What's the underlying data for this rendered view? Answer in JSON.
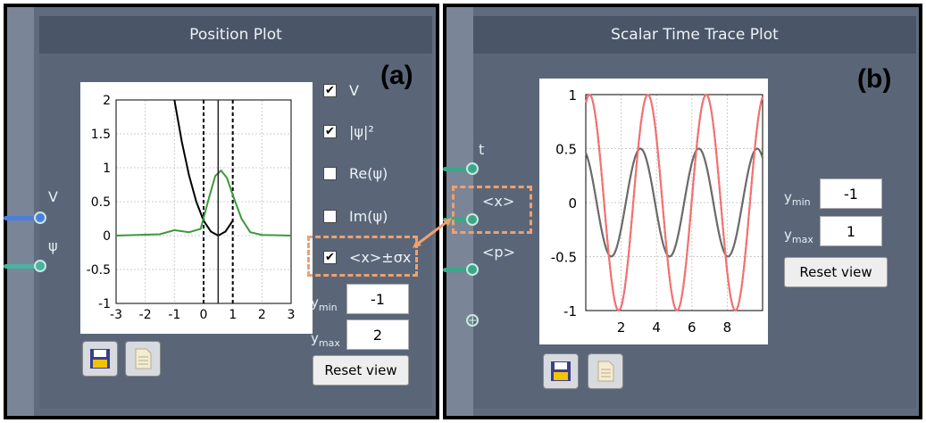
{
  "panel_a": {
    "tag": "(a)",
    "title": "Position Plot",
    "ports": [
      {
        "label": "V",
        "color": "#4a7fe0"
      },
      {
        "label": "ψ",
        "color": "#4ab3a0"
      }
    ],
    "checkboxes": [
      {
        "label": "V",
        "checked": true
      },
      {
        "label": "|ψ|²",
        "checked": true
      },
      {
        "label": "Re(ψ)",
        "checked": false
      },
      {
        "label": "Im(ψ)",
        "checked": false
      },
      {
        "label": "<x>±σx",
        "checked": true
      }
    ],
    "ymin_label": "y",
    "ymin_sub": "min",
    "ymin": "-1",
    "ymax_label": "y",
    "ymax_sub": "max",
    "ymax": "2",
    "reset": "Reset view",
    "icons": [
      "save-icon",
      "document-icon"
    ],
    "chart_data": {
      "type": "line",
      "title": "",
      "xlabel": "",
      "ylabel": "",
      "xlim": [
        -3,
        3
      ],
      "ylim": [
        -1,
        2
      ],
      "xticks": [
        "-3",
        "-2",
        "-1",
        "0",
        "1",
        "2",
        "3"
      ],
      "yticks": [
        "-1",
        "-0.5",
        "0",
        "0.5",
        "1",
        "1.5",
        "2"
      ],
      "grid": true,
      "series": [
        {
          "kind": "potential V",
          "color": "#000000",
          "x": [
            -1.0,
            -0.75,
            -0.5,
            -0.25,
            0.0,
            0.25,
            0.5,
            0.75,
            1.0
          ],
          "y": [
            2.0,
            1.39,
            0.89,
            0.5,
            0.22,
            0.06,
            0.0,
            0.06,
            0.22
          ]
        },
        {
          "kind": "|ψ|²",
          "color": "#3a9a3a",
          "x": [
            -3,
            -1.5,
            -1.0,
            -0.5,
            -0.1,
            0.2,
            0.4,
            0.6,
            0.8,
            1.0,
            1.3,
            1.6,
            2.0,
            3
          ],
          "y": [
            0,
            0.02,
            0.08,
            0.05,
            0.1,
            0.58,
            0.88,
            0.96,
            0.85,
            0.6,
            0.25,
            0.05,
            0.01,
            0
          ]
        },
        {
          "kind": "marker",
          "color": "#222222",
          "x": [
            0.5,
            0.5
          ],
          "y": [
            -1,
            2
          ]
        }
      ],
      "dashed_vlines": [
        0.0,
        1.0
      ]
    }
  },
  "panel_b": {
    "tag": "(b)",
    "title": "Scalar Time Trace Plot",
    "ports": [
      {
        "label": "t",
        "color": "#4ab3a0"
      },
      {
        "label": "<x>",
        "color": "#4ab3a0"
      },
      {
        "label": "<p>",
        "color": "#4ab3a0"
      }
    ],
    "add_icon": "add-port-icon",
    "ymin_label": "y",
    "ymin_sub": "min",
    "ymin": "-1",
    "ymax_label": "y",
    "ymax_sub": "max",
    "ymax": "1",
    "reset": "Reset view",
    "icons": [
      "save-icon",
      "document-icon"
    ],
    "chart_data": {
      "type": "line",
      "title": "",
      "xlabel": "",
      "ylabel": "",
      "xlim": [
        0,
        10
      ],
      "ylim": [
        -1,
        1
      ],
      "xticks": [
        "2",
        "4",
        "6",
        "8"
      ],
      "yticks": [
        "1",
        "0.5",
        "0",
        "-0.5",
        "-1"
      ],
      "grid": true,
      "series": [
        {
          "kind": "<x> dark",
          "color": "#111111",
          "amplitude": 0.5,
          "period": 3.3,
          "phase": 0.4
        },
        {
          "kind": "<x> light",
          "color": "#777777",
          "amplitude": 0.5,
          "period": 3.3,
          "phase": 0.4
        },
        {
          "kind": "<p> dark",
          "color": "#ee1111",
          "amplitude": 1.0,
          "period": 3.3,
          "phase": -0.4
        },
        {
          "kind": "<p> light",
          "color": "#f08080",
          "amplitude": 1.0,
          "period": 3.3,
          "phase": -0.4
        }
      ]
    }
  },
  "colors": {
    "panel": "#5f6b7e",
    "header": "#4a5567",
    "highlight": "#f0a070"
  }
}
